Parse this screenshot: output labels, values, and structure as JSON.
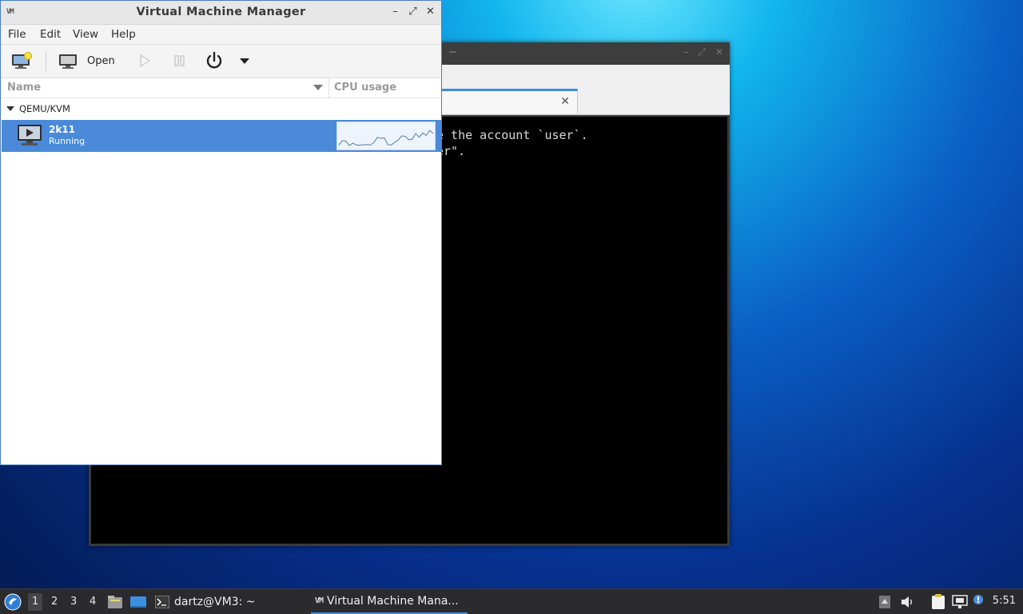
{
  "background_terminal": {
    "title": "~",
    "tab_close": "✕",
    "lines": [
      "e the account `user`.",
      "er\"."
    ]
  },
  "vmm": {
    "title": "Virtual Machine Manager",
    "app_icon_text": "VM",
    "menu": [
      "File",
      "Edit",
      "View",
      "Help"
    ],
    "toolbar": {
      "new_vm_icon": "new-vm-icon",
      "open_label": "Open",
      "run_icon": "play-icon",
      "pause_icon": "pause-icon",
      "shutdown_icon": "power-icon",
      "shutdown_menu_icon": "chevron-down-icon"
    },
    "columns": {
      "name": "Name",
      "cpu": "CPU usage"
    },
    "groups": [
      {
        "label": "QEMU/KVM",
        "vms": [
          {
            "name": "2k11",
            "status": "Running",
            "cpu_history": [
              12,
              30,
              28,
              10,
              20,
              12,
              11,
              13,
              14,
              12,
              22,
              44,
              40,
              42,
              14,
              12,
              24,
              33,
              50,
              48,
              34,
              36,
              60,
              45,
              62,
              52,
              73,
              60
            ]
          }
        ]
      }
    ],
    "colors": {
      "selection": "#4a8ad8",
      "border": "#4a7fc0"
    }
  },
  "taskbar": {
    "workspaces": [
      "1",
      "2",
      "3",
      "4"
    ],
    "active_workspace": "1",
    "tasks": [
      {
        "label": "dartz@VM3: ~",
        "icon": "terminal-icon"
      },
      {
        "label": "Virtual Machine Mana...",
        "icon": "vmm-icon"
      }
    ],
    "clock": "5:51",
    "accent": "#3b8de0"
  }
}
